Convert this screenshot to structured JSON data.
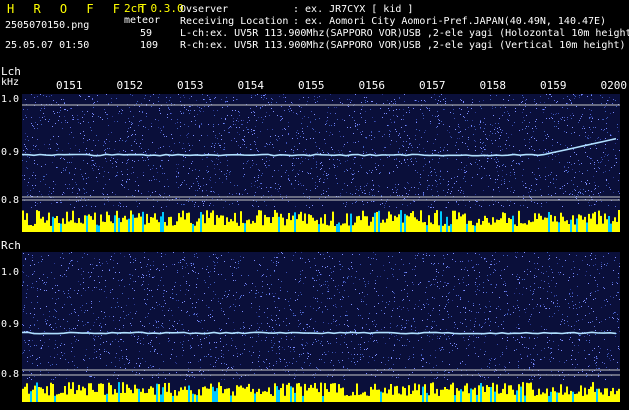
{
  "header": {
    "brand": "H R O F F T",
    "version": "2ch 0.3.0",
    "filename": "2505070150.png",
    "meteor_label": "meteor",
    "datetime": "25.05.07 01:50",
    "count_l": "59",
    "count_r": "109",
    "observer_label": "Ovserver",
    "observer_value": ": ex. JR7CYX [ kid ]",
    "location_label": "Receiving Location",
    "location_value": ": ex. Aomori City Aomori-Pref.JAPAN(40.49N, 140.47E)",
    "lch_info": "L-ch:ex. UV5R 113.900Mhz(SAPPORO VOR)USB ,2-ele yagi (Holozontal 10m height",
    "rch_info": "R-ch:ex. UV5R 113.900Mhz(SAPPORO VOR)USB ,2-ele yagi (Vertical 10m height)"
  },
  "lch": {
    "label": "Lch",
    "unit": "kHz",
    "y_ticks": [
      "1.0",
      "0.9",
      "0.8"
    ]
  },
  "rch": {
    "label": "Rch",
    "y_ticks": [
      "1.0",
      "0.9",
      "0.8"
    ]
  },
  "time_ticks": [
    "0151",
    "0152",
    "0153",
    "0154",
    "0155",
    "0156",
    "0157",
    "0158",
    "0159",
    "0200"
  ],
  "colors": {
    "background": "#000000",
    "panel": "#0a0f3a",
    "text_white": "#ffffff",
    "text_yellow": "#ffff00",
    "text_cyan": "#00ffff",
    "trace": "#b0e0ff",
    "level_bar": "#ffff00",
    "level_bar_alt": "#00c8ff",
    "tick_color": "#ffff00",
    "ref_line": "#c8c8c8"
  }
}
